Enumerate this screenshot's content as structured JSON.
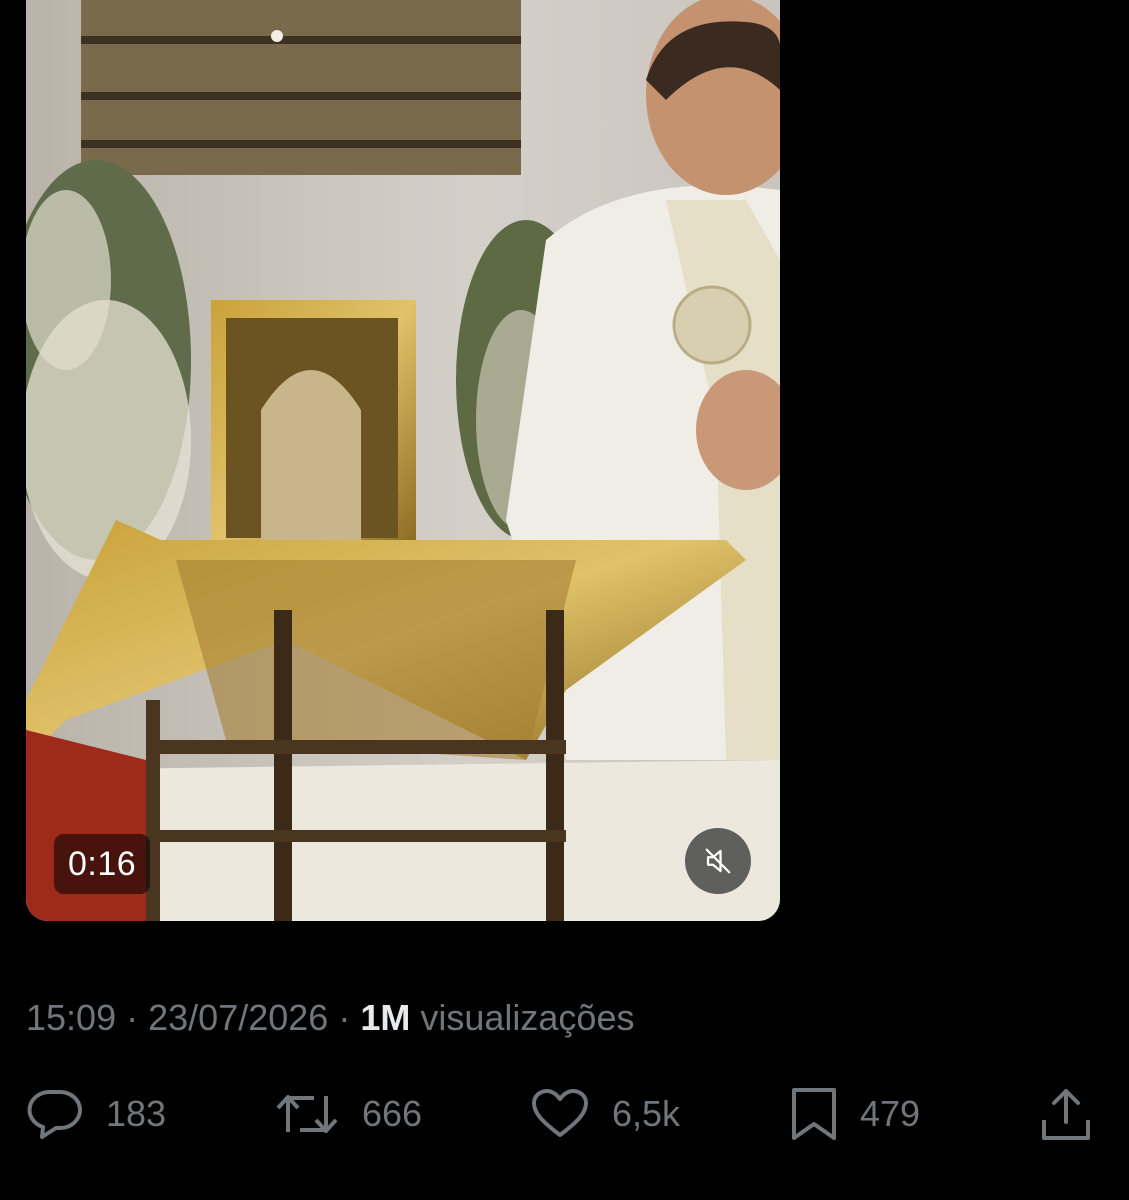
{
  "video": {
    "duration": "0:16",
    "mute_icon": "speaker-muted-icon"
  },
  "tweet_meta": {
    "time": "15:09",
    "separator": "·",
    "date": "23/07/2026",
    "views_count": "1M",
    "views_label": "visualizações"
  },
  "actions": {
    "replies": {
      "icon": "reply-icon",
      "count": "183"
    },
    "reposts": {
      "icon": "repost-icon",
      "count": "666"
    },
    "likes": {
      "icon": "heart-icon",
      "count": "6,5k"
    },
    "bookmarks": {
      "icon": "bookmark-icon",
      "count": "479"
    },
    "share": {
      "icon": "share-icon"
    }
  },
  "colors": {
    "background": "#000000",
    "secondary_text": "#71767b",
    "primary_text": "#e7e9ea"
  }
}
